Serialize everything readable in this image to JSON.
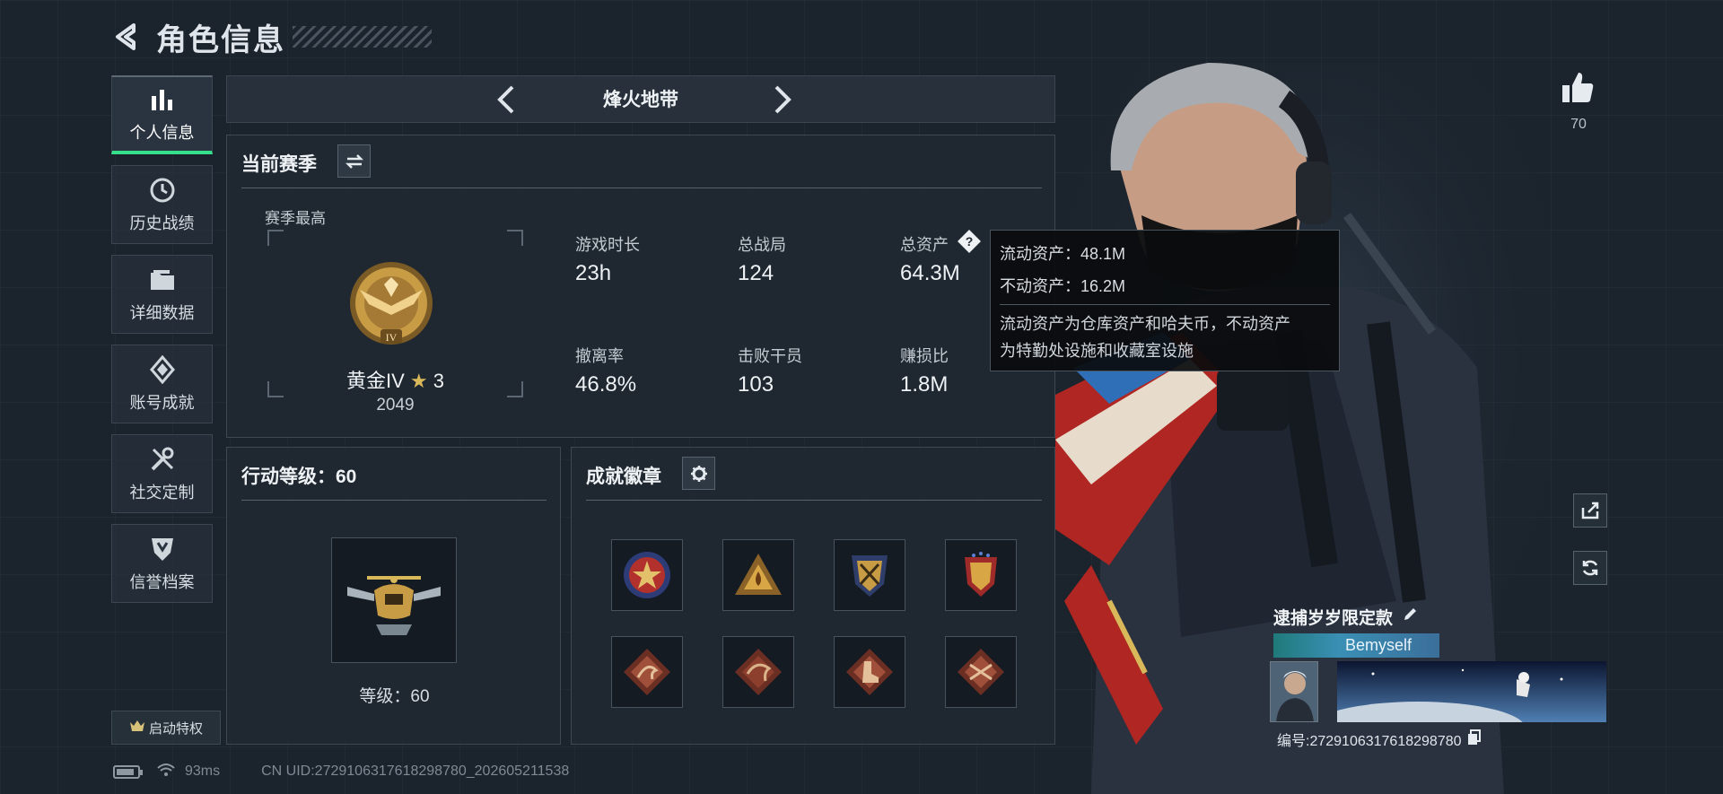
{
  "header": {
    "title": "角色信息"
  },
  "nav": {
    "items": [
      {
        "label": "个人信息",
        "icon": "bar-chart-icon",
        "active": true
      },
      {
        "label": "历史战绩",
        "icon": "clock-icon"
      },
      {
        "label": "详细数据",
        "icon": "folder-icon"
      },
      {
        "label": "账号成就",
        "icon": "diamond-icon"
      },
      {
        "label": "社交定制",
        "icon": "tools-icon"
      },
      {
        "label": "信誉档案",
        "icon": "shield-icon"
      }
    ],
    "privilege_label": "启动特权"
  },
  "mode": {
    "title": "烽火地带"
  },
  "season": {
    "title": "当前赛季",
    "best_label": "赛季最高",
    "rank_name": "黄金IV",
    "rank_stars": "3",
    "rank_points": "2049",
    "rank_badge_numeral": "IV",
    "stats": [
      {
        "label": "游戏时长",
        "value": "23h"
      },
      {
        "label": "总战局",
        "value": "124"
      },
      {
        "label": "总资产",
        "value": "64.3M"
      },
      {
        "label": "撤离率",
        "value": "46.8%"
      },
      {
        "label": "击败干员",
        "value": "103"
      },
      {
        "label": "赚损比",
        "value": "1.8M"
      }
    ]
  },
  "tooltip": {
    "liquid": "流动资产：48.1M",
    "fixed": "不动资产：16.2M",
    "desc_line1": "流动资产为仓库资产和哈夫币，不动资产",
    "desc_line2": "为特勤处设施和收藏室设施"
  },
  "level": {
    "title": "行动等级：60",
    "label": "等级：60"
  },
  "badges": {
    "title": "成就徽章",
    "items": [
      "star-medal-icon",
      "fire-triangle-icon",
      "crossed-guns-shield-icon",
      "flag-shield-icon",
      "dragon-diamond-icon",
      "dragon-diamond-alt-icon",
      "boot-diamond-icon",
      "crossed-rifles-diamond-icon"
    ]
  },
  "like": {
    "count": "70"
  },
  "card": {
    "title": "逮捕岁岁限定款",
    "name": "Bemyself",
    "id_text": "编号:2729106317618298780"
  },
  "status": {
    "battery_level": 0.85,
    "ping": "93ms",
    "uid": "CN UID:2729106317618298780_202605211538"
  },
  "colors": {
    "accent": "#35e08a",
    "panel": "#202932",
    "gold": "#c89b45"
  }
}
